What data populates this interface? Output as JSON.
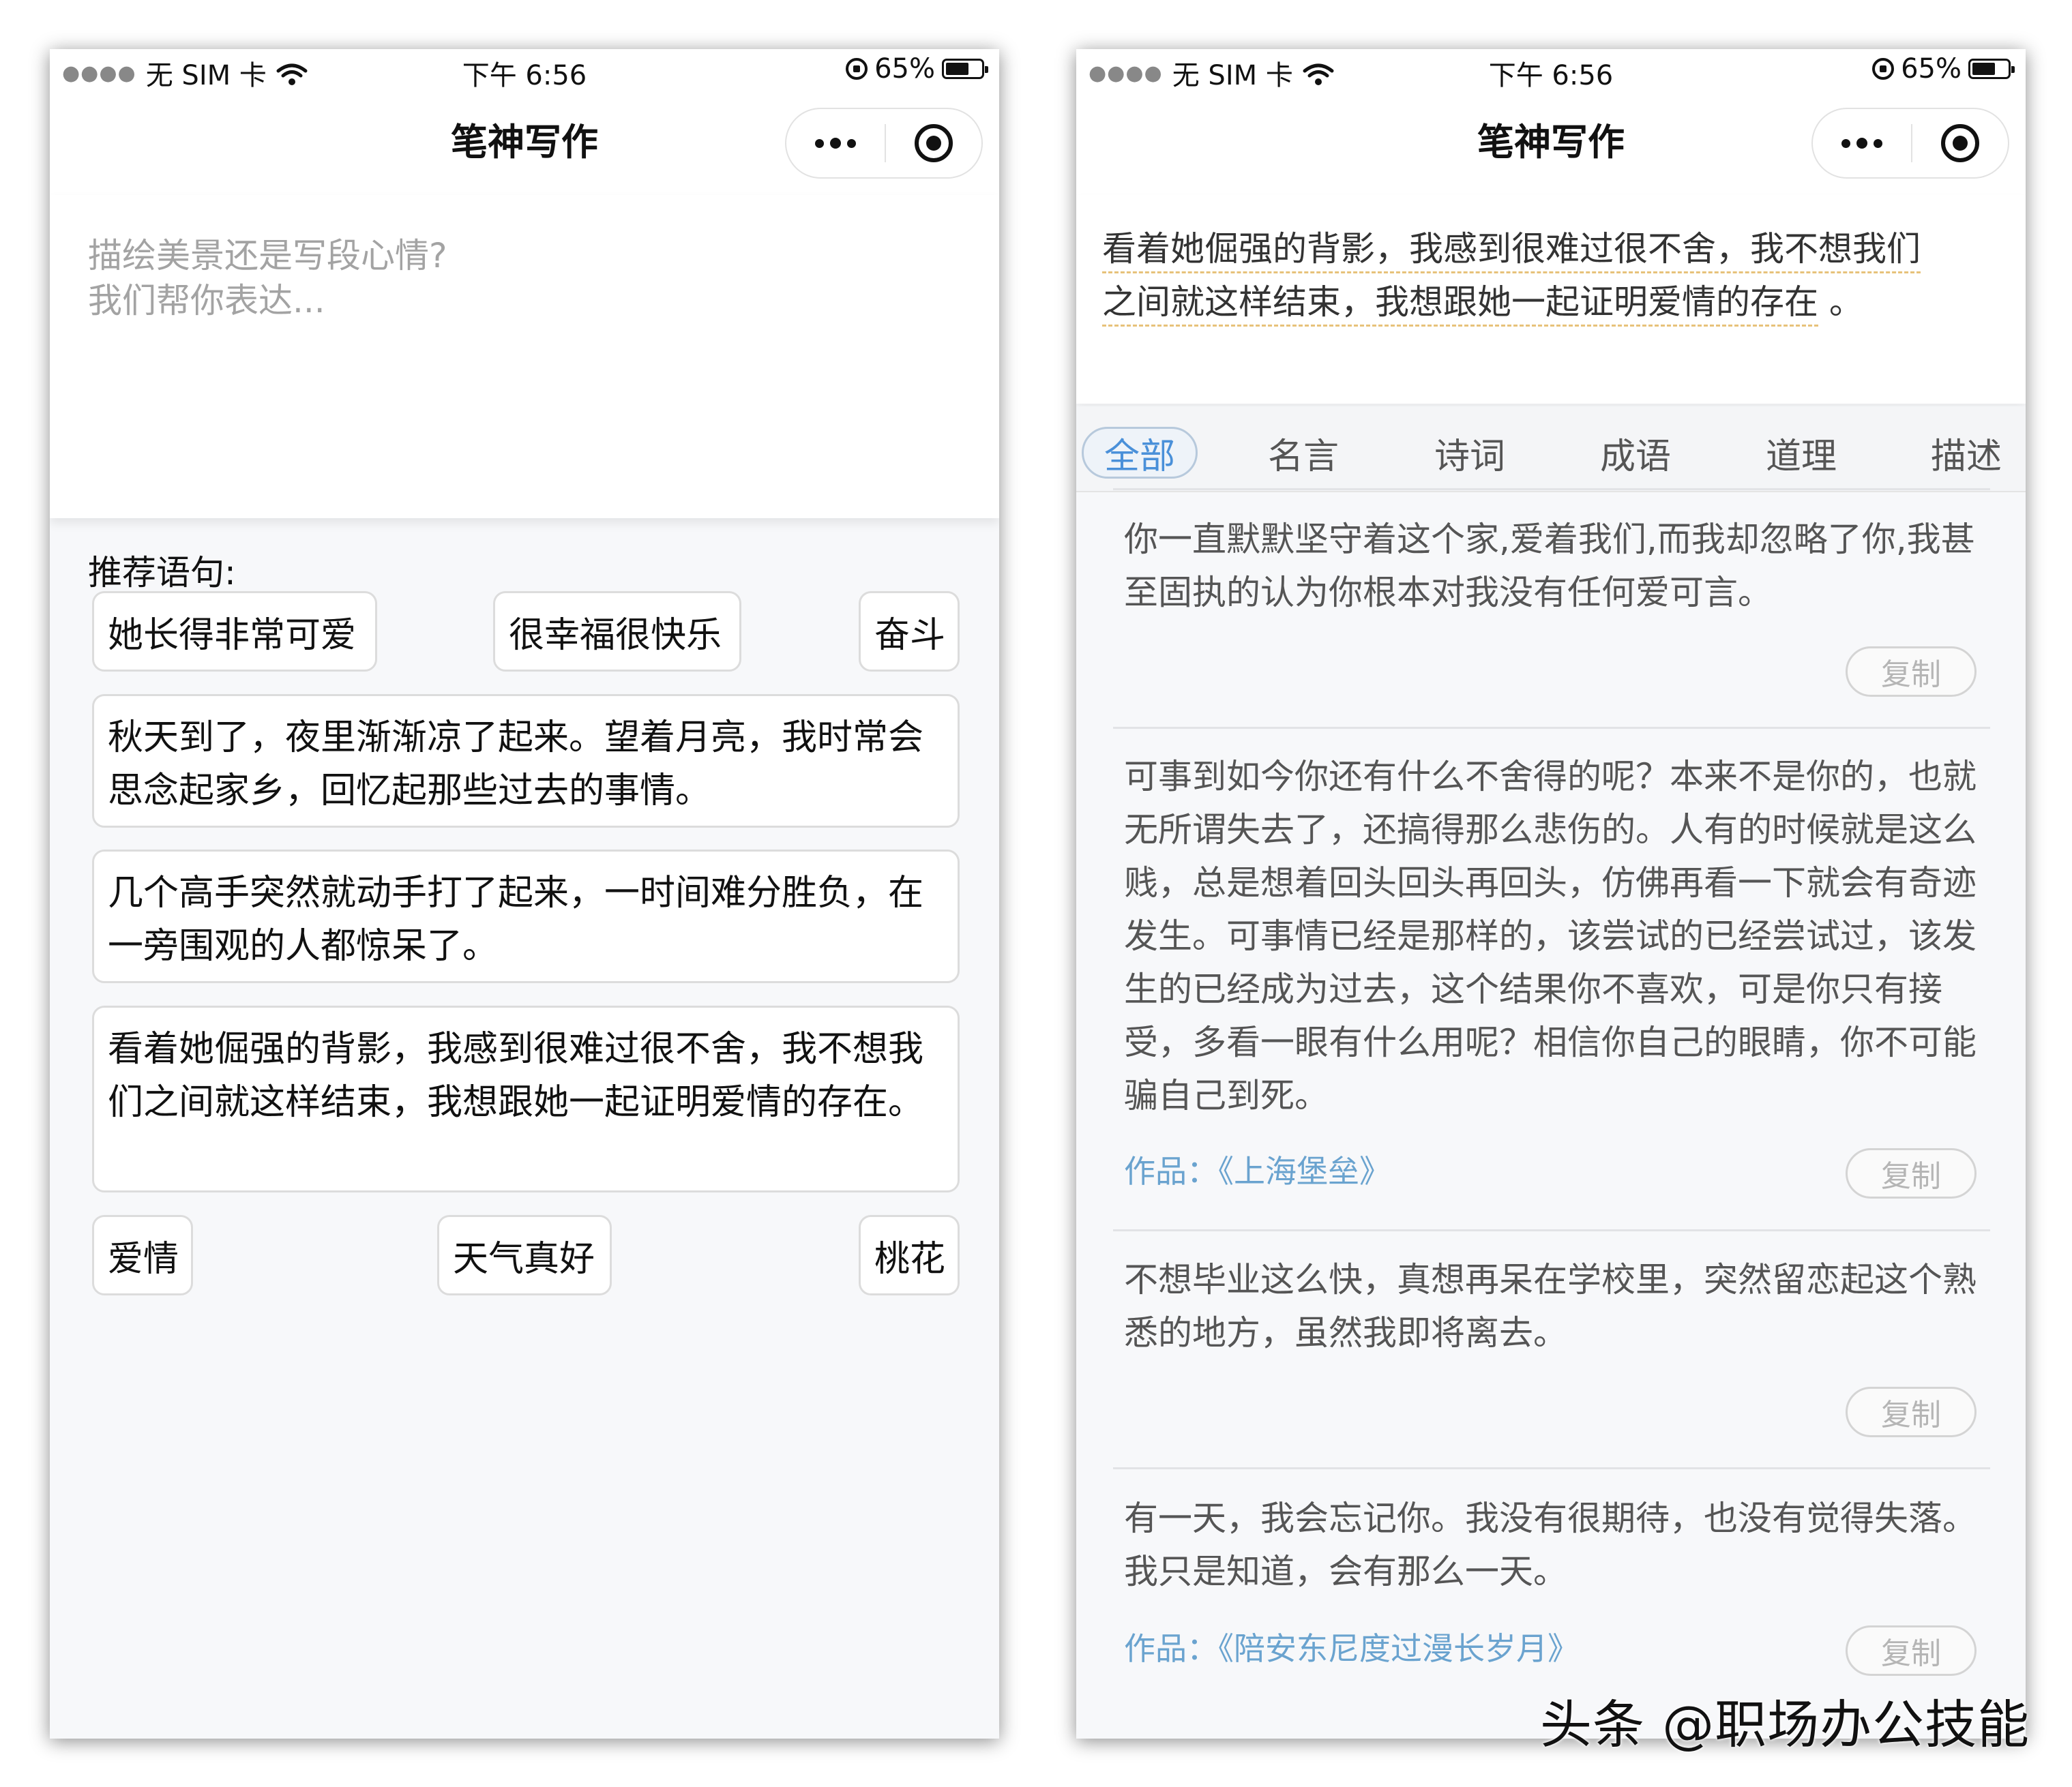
{
  "status_bar": {
    "carrier": "无 SIM 卡",
    "time": "下午 6:56",
    "battery": "65%",
    "battery_level": 0.65
  },
  "app": {
    "title": "笔神写作"
  },
  "left": {
    "input_placeholder": "描绘美景还是写段心情?\n我们帮你表达...",
    "recommend_label": "推荐语句:",
    "chips_row1": [
      "她长得非常可爱",
      "很幸福很快乐",
      "奋斗"
    ],
    "sentences": [
      "秋天到了，夜里渐渐凉了起来。望着月亮，我时常会思念起家乡，回忆起那些过去的事情。",
      "几个高手突然就动手打了起来，一时间难分胜负，在一旁围观的人都惊呆了。",
      "看着她倔强的背影，我感到很难过很不舍，我不想我们之间就这样结束，我想跟她一起证明爱情的存在。"
    ],
    "chips_row2": [
      "爱情",
      "天气真好",
      "桃花"
    ]
  },
  "right": {
    "selected_text_line1": "看着她倔强的背影，我感到很难过很不舍，我不想我们",
    "selected_text_line2": "之间就这样结束，我想跟她一起证明爱情的存在",
    "selected_text_end": "。",
    "tabs": [
      "全部",
      "名言",
      "诗词",
      "成语",
      "道理",
      "描述"
    ],
    "active_tab": "全部",
    "results": [
      {
        "text": "你一直默默坚守着这个家,爱着我们,而我却忽略了你,我甚至固执的认为你根本对我没有任何爱可言。",
        "work_label": "",
        "work": ""
      },
      {
        "text": "可事到如今你还有什么不舍得的呢？本来不是你的，也就无所谓失去了，还搞得那么悲伤的。人有的时候就是这么贱，总是想着回头回头再回头，仿佛再看一下就会有奇迹发生。可事情已经是那样的，该尝试的已经尝试过，该发生的已经成为过去，这个结果你不喜欢，可是你只有接受，多看一眼有什么用呢？相信你自己的眼睛，你不可能骗自己到死。",
        "work_label": "作品：",
        "work": "《上海堡垒》"
      },
      {
        "text": "不想毕业这么快，真想再呆在学校里，突然留恋起这个熟悉的地方，虽然我即将离去。",
        "work_label": "",
        "work": ""
      },
      {
        "text": "有一天，我会忘记你。我没有很期待，也没有觉得失落。我只是知道，会有那么一天。",
        "work_label": "作品：",
        "work": "《陪安东尼度过漫长岁月》"
      }
    ],
    "copy_label": "复制"
  },
  "watermark": "头条 @职场办公技能",
  "colors": {
    "accent": "#4a90d9",
    "work_link": "#6aa3cf",
    "underline": "#e7c27a"
  }
}
